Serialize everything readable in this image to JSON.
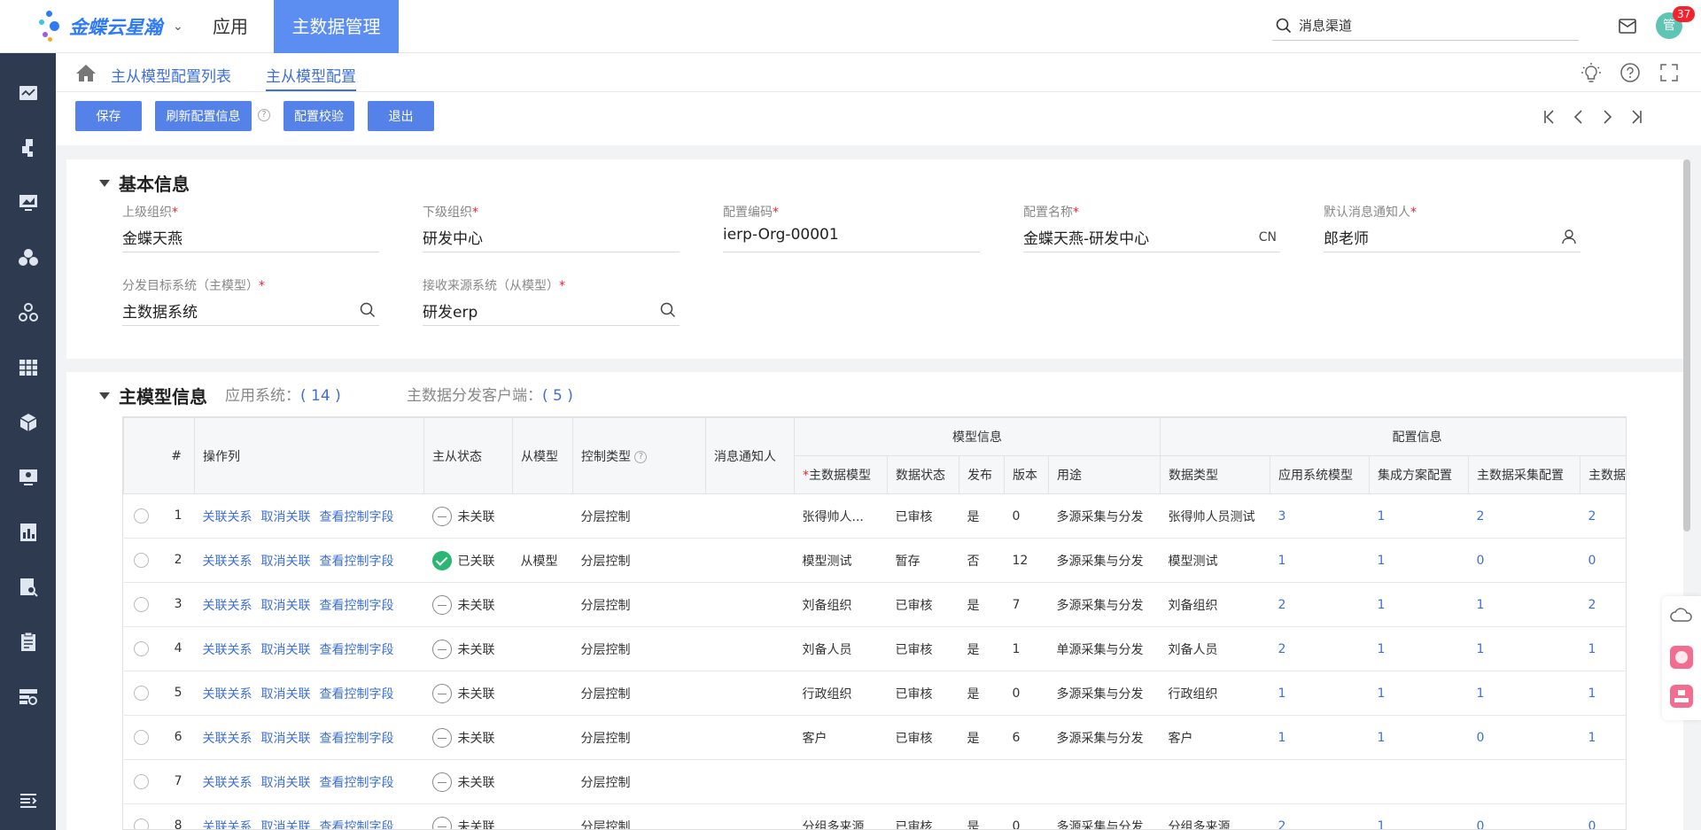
{
  "top": {
    "logo_text": "金蝶云星瀚",
    "nav_app": "应用",
    "nav_active": "主数据管理",
    "search_text": "消息渠道",
    "avatar_text": "管",
    "badge_count": "37"
  },
  "breadcrumb": {
    "items": [
      "主从模型配置列表",
      "主从模型配置"
    ]
  },
  "toolbar": {
    "save": "保存",
    "refresh": "刷新配置信息",
    "validate": "配置校验",
    "exit": "退出",
    "help_mark": "?"
  },
  "basic": {
    "title": "基本信息",
    "fields": [
      {
        "label": "上级组织",
        "value": "金蝶天燕"
      },
      {
        "label": "下级组织",
        "value": "研发中心"
      },
      {
        "label": "配置编码",
        "value": "ierp-Org-00001"
      },
      {
        "label": "配置名称",
        "value": "金蝶天燕-研发中心",
        "suffix": "CN"
      },
      {
        "label": "默认消息通知人",
        "value": "郎老师"
      },
      {
        "label": "分发目标系统（主模型）",
        "value": "主数据系统"
      },
      {
        "label": "接收来源系统（从模型）",
        "value": "研发erp"
      }
    ],
    "required_mark": "*"
  },
  "master": {
    "title": "主模型信息",
    "app_system_label": "应用系统：",
    "app_system_count": "( 14 )",
    "client_label": "主数据分发客户端：",
    "client_count": "( 5 )",
    "group_headers": {
      "model": "模型信息",
      "config": "配置信息"
    },
    "headers": {
      "idx": "#",
      "ops": "操作列",
      "status": "主从状态",
      "slave": "从模型",
      "control": "控制类型",
      "notify": "消息通知人",
      "master_model": "主数据模型",
      "data_status": "数据状态",
      "publish": "发布",
      "version": "版本",
      "usage": "用途",
      "data_type": "数据类型",
      "app_model": "应用系统模型",
      "integration": "集成方案配置",
      "collect": "主数据采集配置",
      "more": "主数据分发"
    },
    "op_labels": [
      "关联关系",
      "取消关联",
      "查看控制字段"
    ],
    "rows": [
      {
        "idx": "1",
        "status": "未关联",
        "linked": false,
        "slave": "",
        "control": "分层控制",
        "model": "张得帅人...",
        "dstatus": "已审核",
        "pub": "是",
        "ver": "0",
        "usage": "多源采集与分发",
        "dtype": "张得帅人员测试",
        "c1": "3",
        "c2": "1",
        "c3": "2",
        "c4": "2"
      },
      {
        "idx": "2",
        "status": "已关联",
        "linked": true,
        "slave": "从模型",
        "control": "分层控制",
        "model": "模型测试",
        "dstatus": "暂存",
        "pub": "否",
        "ver": "12",
        "usage": "多源采集与分发",
        "dtype": "模型测试",
        "c1": "1",
        "c2": "1",
        "c3": "0",
        "c4": "0"
      },
      {
        "idx": "3",
        "status": "未关联",
        "linked": false,
        "slave": "",
        "control": "分层控制",
        "model": "刘备组织",
        "dstatus": "已审核",
        "pub": "是",
        "ver": "7",
        "usage": "多源采集与分发",
        "dtype": "刘备组织",
        "c1": "2",
        "c2": "1",
        "c3": "1",
        "c4": "2"
      },
      {
        "idx": "4",
        "status": "未关联",
        "linked": false,
        "slave": "",
        "control": "分层控制",
        "model": "刘备人员",
        "dstatus": "已审核",
        "pub": "是",
        "ver": "1",
        "usage": "单源采集与分发",
        "dtype": "刘备人员",
        "c1": "2",
        "c2": "1",
        "c3": "1",
        "c4": "1"
      },
      {
        "idx": "5",
        "status": "未关联",
        "linked": false,
        "slave": "",
        "control": "分层控制",
        "model": "行政组织",
        "dstatus": "已审核",
        "pub": "是",
        "ver": "0",
        "usage": "多源采集与分发",
        "dtype": "行政组织",
        "c1": "1",
        "c2": "1",
        "c3": "1",
        "c4": "1"
      },
      {
        "idx": "6",
        "status": "未关联",
        "linked": false,
        "slave": "",
        "control": "分层控制",
        "model": "客户",
        "dstatus": "已审核",
        "pub": "是",
        "ver": "6",
        "usage": "多源采集与分发",
        "dtype": "客户",
        "c1": "1",
        "c2": "1",
        "c3": "0",
        "c4": "1"
      },
      {
        "idx": "7",
        "status": "未关联",
        "linked": false,
        "slave": "",
        "control": "分层控制",
        "model": "",
        "dstatus": "",
        "pub": "",
        "ver": "",
        "usage": "",
        "dtype": "",
        "c1": "",
        "c2": "",
        "c3": "",
        "c4": ""
      },
      {
        "idx": "8",
        "status": "未关联",
        "linked": false,
        "slave": "",
        "control": "分层控制",
        "model": "分组多来源",
        "dstatus": "已审核",
        "pub": "是",
        "ver": "0",
        "usage": "多源采集与分发",
        "dtype": "分组多来源",
        "c1": "2",
        "c2": "1",
        "c3": "0",
        "c4": "0"
      }
    ]
  }
}
